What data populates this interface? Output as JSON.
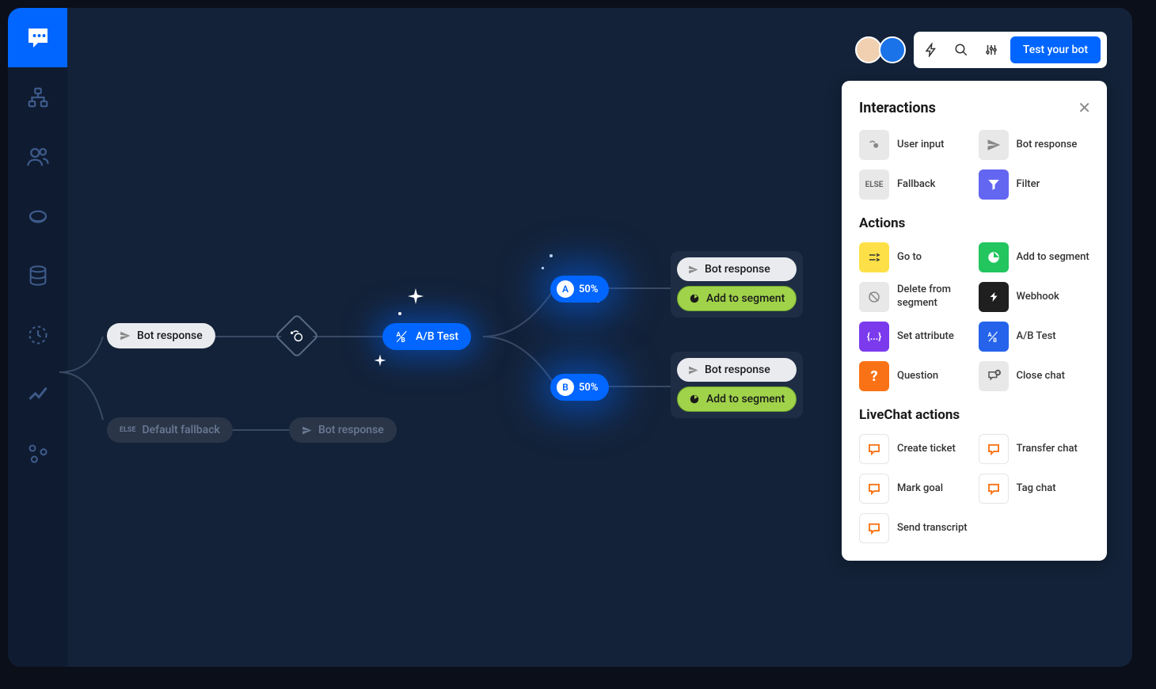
{
  "topbar": {
    "test_button": "Test your bot"
  },
  "flow": {
    "bot_response": "Bot response",
    "default_fallback": "Default fallback",
    "ab_test": "A/B Test",
    "split_a": {
      "letter": "A",
      "pct": "50%"
    },
    "split_b": {
      "letter": "B",
      "pct": "50%"
    },
    "group_a": {
      "row1": "Bot response",
      "row2": "Add to segment"
    },
    "group_b": {
      "row1": "Bot response",
      "row2": "Add to segment"
    }
  },
  "panel": {
    "title": "Interactions",
    "sections": {
      "interactions": [
        {
          "label": "User input",
          "icon": "user-input",
          "cls": "ic-gray"
        },
        {
          "label": "Bot response",
          "icon": "send",
          "cls": "ic-gray"
        },
        {
          "label": "Fallback",
          "icon": "else",
          "cls": "ic-gray"
        },
        {
          "label": "Filter",
          "icon": "funnel",
          "cls": "ic-indigo"
        }
      ],
      "actions_title": "Actions",
      "actions": [
        {
          "label": "Go to",
          "icon": "goto",
          "cls": "ic-yellow"
        },
        {
          "label": "Add to segment",
          "icon": "pie",
          "cls": "ic-green"
        },
        {
          "label": "Delete from segment",
          "icon": "delete",
          "cls": "ic-gray"
        },
        {
          "label": "Webhook",
          "icon": "webhook",
          "cls": "ic-black"
        },
        {
          "label": "Set attribute",
          "icon": "attr",
          "cls": "ic-purple"
        },
        {
          "label": "A/B Test",
          "icon": "abtest",
          "cls": "ic-blue"
        },
        {
          "label": "Question",
          "icon": "question",
          "cls": "ic-orange"
        },
        {
          "label": "Close chat",
          "icon": "close-chat",
          "cls": "ic-gray"
        }
      ],
      "livechat_title": "LiveChat actions",
      "livechat": [
        {
          "label": "Create ticket",
          "icon": "lc",
          "cls": "ic-white"
        },
        {
          "label": "Transfer chat",
          "icon": "lc",
          "cls": "ic-white"
        },
        {
          "label": "Mark goal",
          "icon": "lc",
          "cls": "ic-white"
        },
        {
          "label": "Tag chat",
          "icon": "lc",
          "cls": "ic-white"
        },
        {
          "label": "Send transcript",
          "icon": "lc",
          "cls": "ic-white"
        }
      ]
    }
  }
}
